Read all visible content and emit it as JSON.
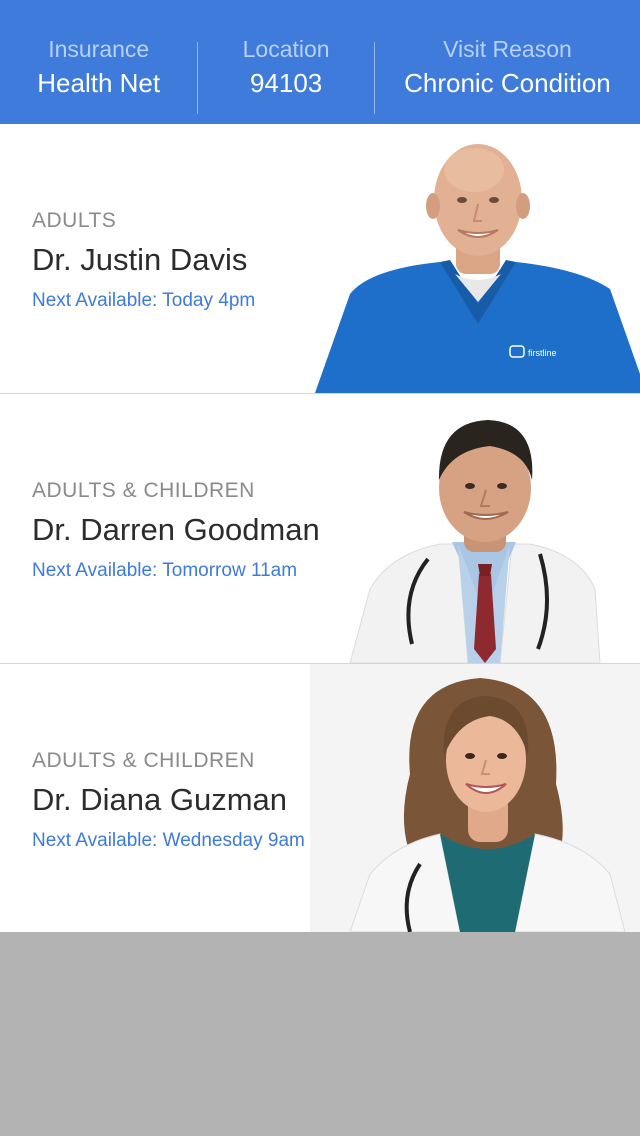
{
  "filters": [
    {
      "label": "Insurance",
      "value": "Health Net"
    },
    {
      "label": "Location",
      "value": "94103"
    },
    {
      "label": "Visit Reason",
      "value": "Chronic Condition"
    }
  ],
  "doctors": [
    {
      "specialty": "ADULTS",
      "name": "Dr. Justin Davis",
      "availability": "Next Available: Today 4pm",
      "scrub_logo": "firstline"
    },
    {
      "specialty": "ADULTS & CHILDREN",
      "name": "Dr. Darren Goodman",
      "availability": "Next Available: Tomorrow 11am"
    },
    {
      "specialty": "ADULTS & CHILDREN",
      "name": "Dr. Diana Guzman",
      "availability": "Next Available: Wednesday 9am"
    }
  ],
  "colors": {
    "header_bg": "#3e7bdb",
    "accent": "#3d7bdb",
    "empty_bg": "#b3b3b3"
  }
}
